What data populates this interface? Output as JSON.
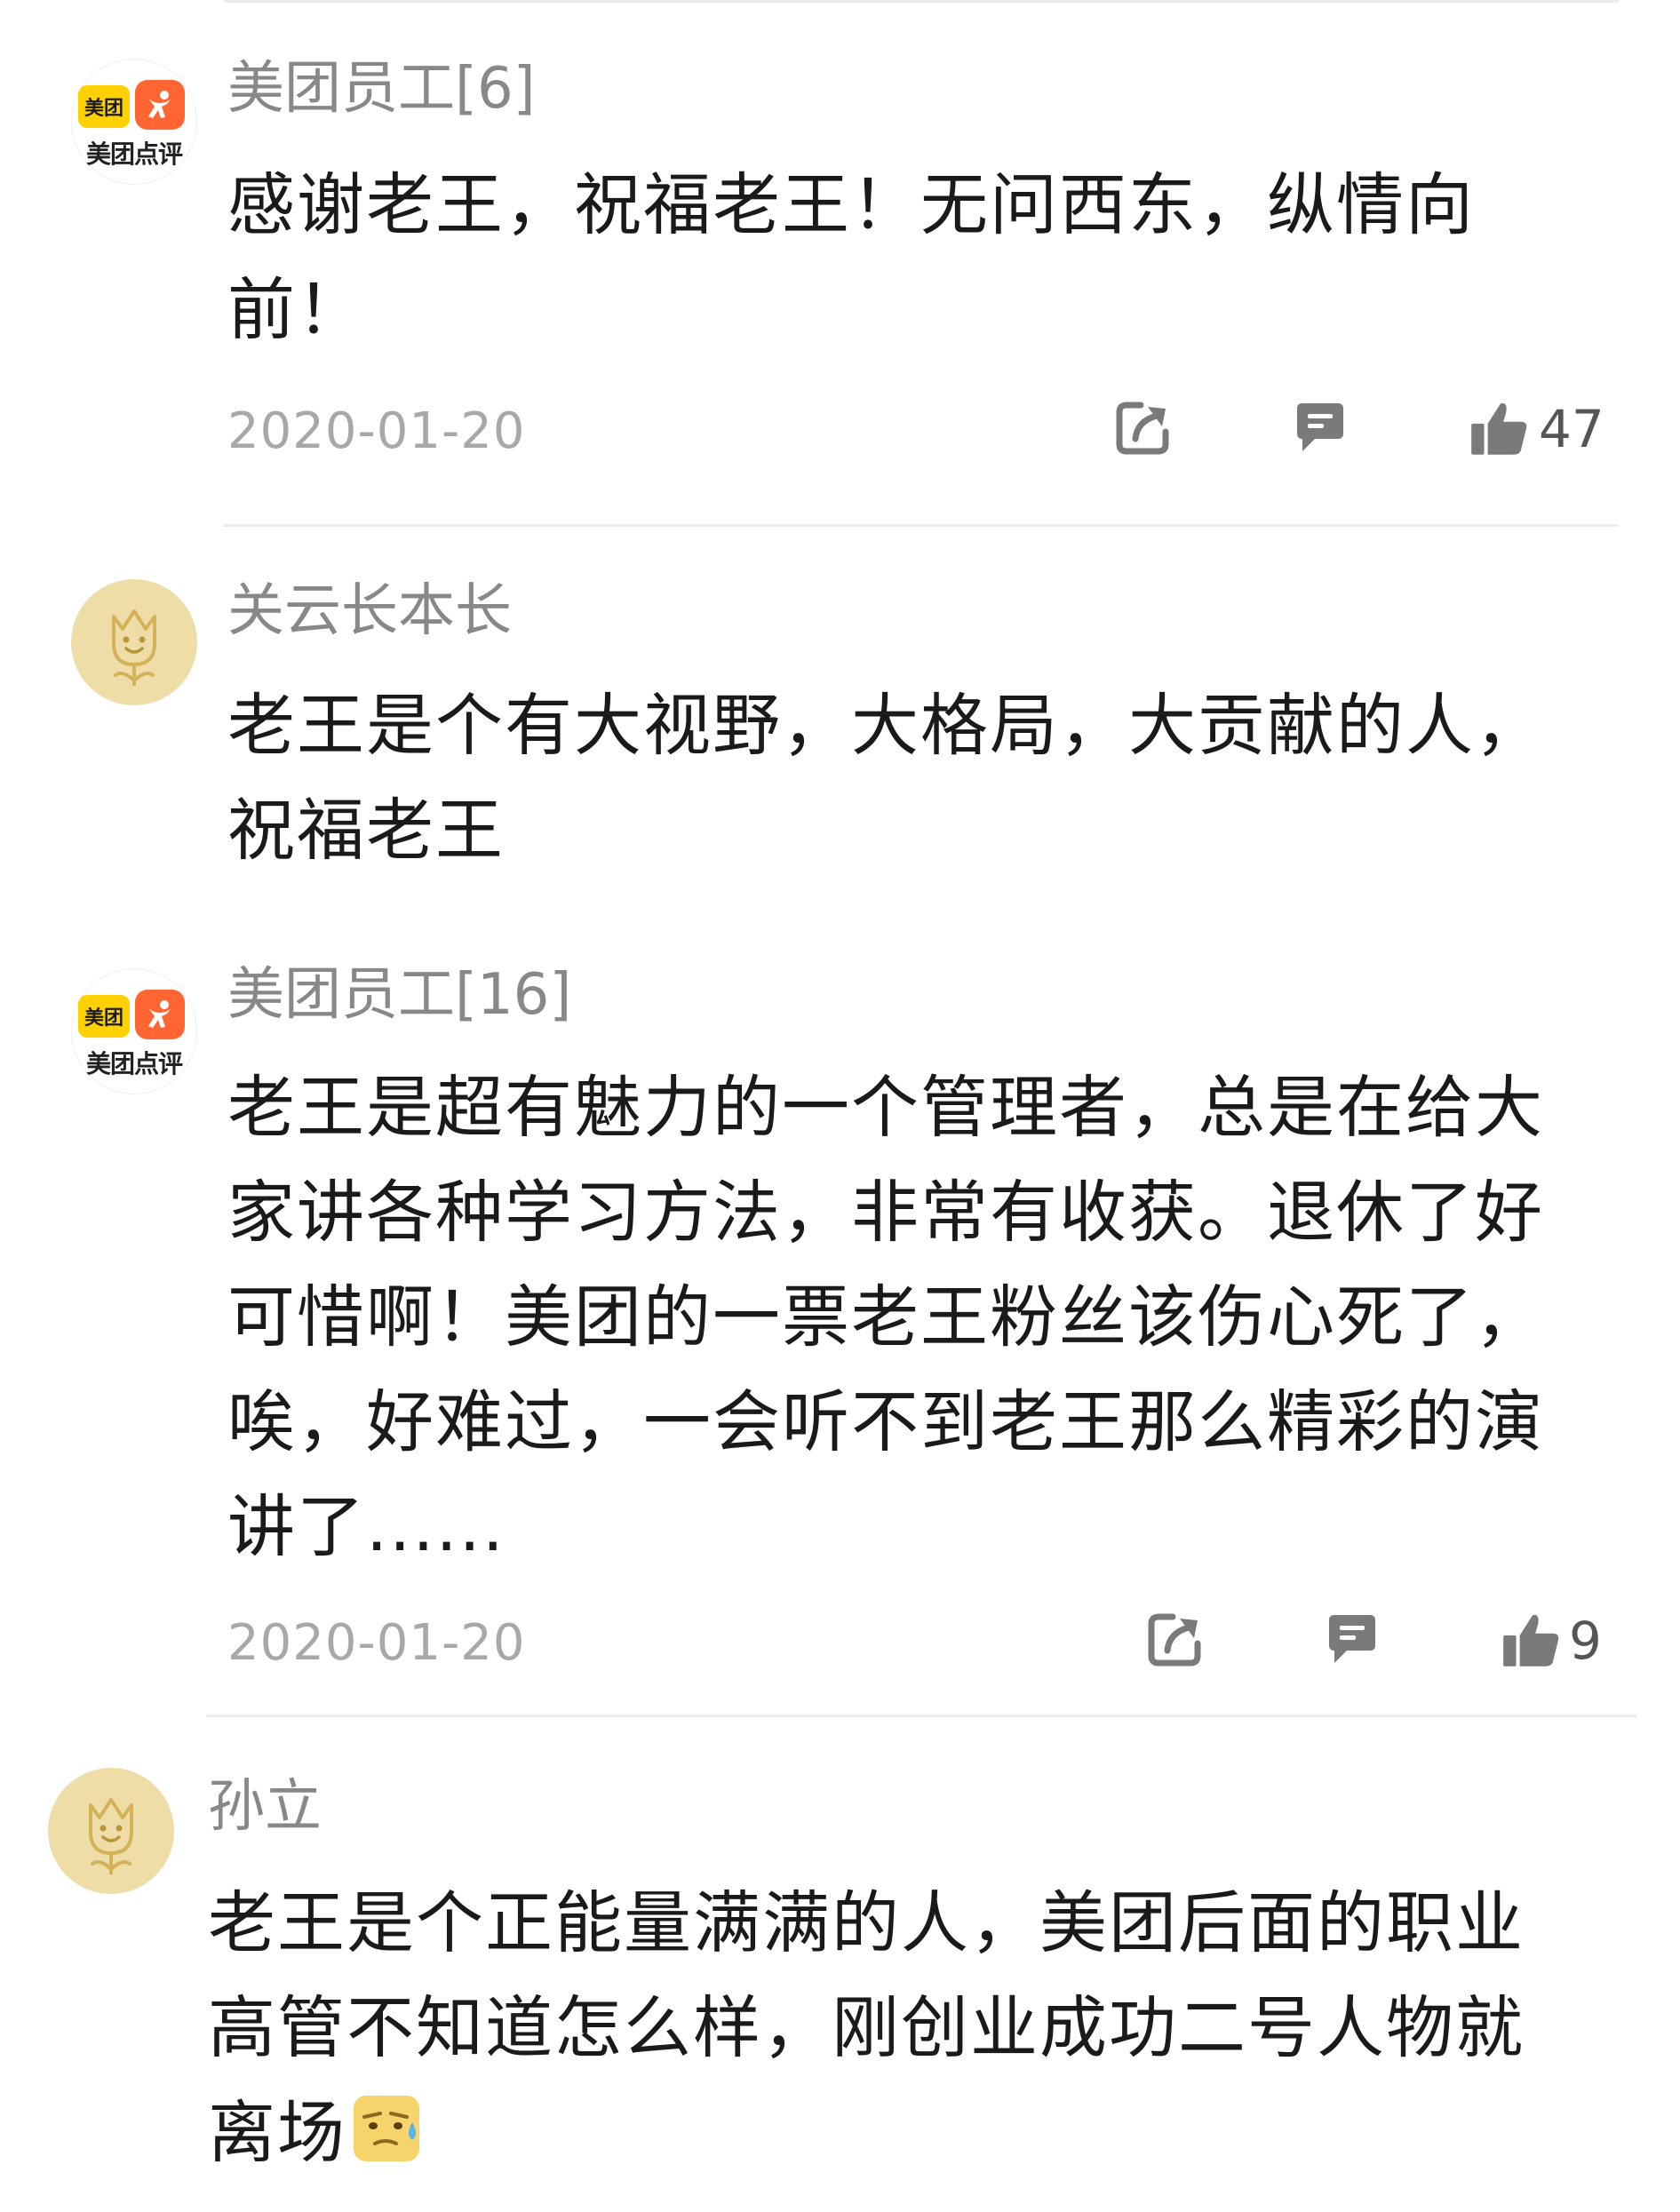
{
  "comments": [
    {
      "username": "美团员工[6]",
      "avatar": "meituan-dianping-logo",
      "avatar_caption": "美团点评",
      "avatar_badge": "美团",
      "text_lines": [
        "感谢老王，祝福老王！无问西东，纵情向",
        "前！"
      ],
      "date": "2020-01-20",
      "likes": "47"
    },
    {
      "username": "关云长本长",
      "avatar": "tulip-avatar",
      "text_lines": [
        "老王是个有大视野，大格局，大贡献的人，",
        "祝福老王"
      ]
    },
    {
      "username": "美团员工[16]",
      "avatar": "meituan-dianping-logo",
      "avatar_caption": "美团点评",
      "avatar_badge": "美团",
      "text_lines": [
        "老王是超有魅力的一个管理者，总是在给大",
        "家讲各种学习方法，非常有收获。退休了好",
        "可惜啊！美团的一票老王粉丝该伤心死了，",
        "唉，好难过，一会听不到老王那么精彩的演",
        "讲了......"
      ],
      "date": "2020-01-20",
      "likes": "9"
    },
    {
      "username": "孙立",
      "avatar": "tulip-avatar",
      "text_lines": [
        "老王是个正能量满满的人，美团后面的职业",
        "高管不知道怎么样，刚创业成功二号人物就",
        "离场"
      ],
      "emoji": "sweat-emoji"
    }
  ],
  "icons": {
    "forward": "share-forward-icon",
    "reply": "comment-reply-icon",
    "like": "thumbs-up-icon"
  },
  "colors": {
    "meituan_yellow": "#ffd100",
    "dianping_orange": "#ff6633",
    "tulip_bg": "#eedda6",
    "icon_gray": "#7a7a7a"
  }
}
